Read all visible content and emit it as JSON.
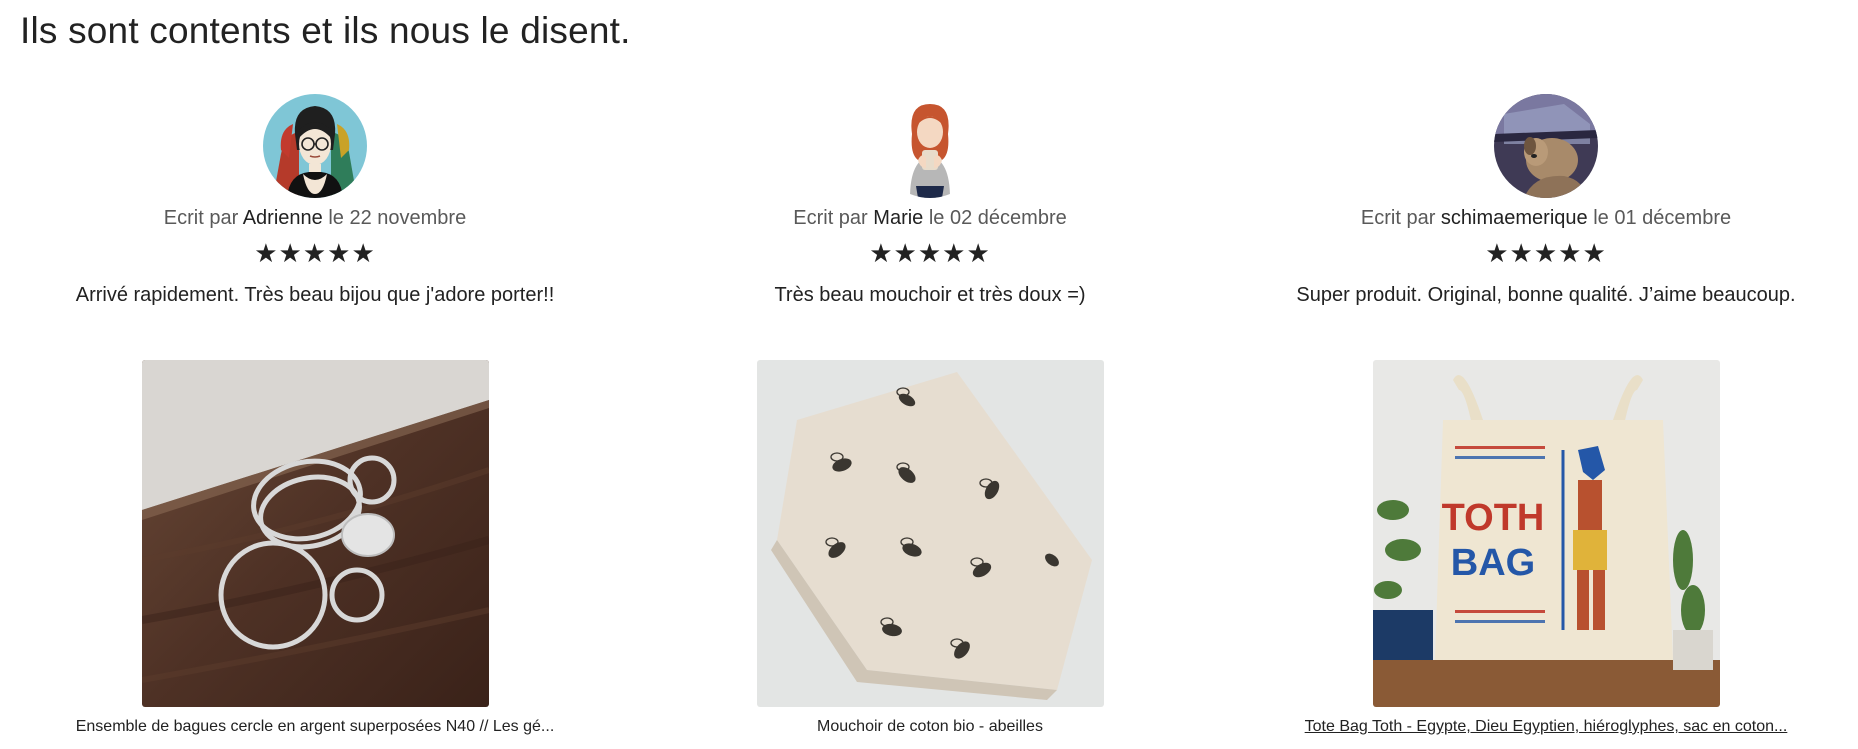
{
  "heading": "Ils sont contents et ils nous le disent.",
  "byline_prefix": "Ecrit par",
  "byline_date_prefix": "le",
  "rating_max": 5,
  "colors": {
    "text": "#222222",
    "muted": "#595959",
    "background": "#ffffff"
  },
  "reviews": [
    {
      "author": "Adrienne",
      "date": "22 novembre",
      "rating": 5,
      "text": "Arrivé rapidement. Très beau bijou que j'adore porter!!",
      "avatar_icon": "illustrated-woman-glasses-avatar",
      "product_title": "Ensemble de bagues cercle en argent superposées N40 // Les gé...",
      "product_image": "silver-circle-rings-photo",
      "product_link": false
    },
    {
      "author": "Marie",
      "date": "02 décembre",
      "rating": 5,
      "text": "Très beau mouchoir et très doux =)",
      "avatar_icon": "illustrated-redhead-woman-avatar",
      "product_title": "Mouchoir de coton bio - abeilles",
      "product_image": "bee-print-handkerchief-photo",
      "product_link": false
    },
    {
      "author": "schimaemerique",
      "date": "01 décembre",
      "rating": 5,
      "text": "Super produit. Original, bonne qualité. J’aime beaucoup.",
      "avatar_icon": "dog-in-car-avatar",
      "product_title": "Tote Bag Toth - Egypte, Dieu Egyptien, hiéroglyphes, sac en coton...",
      "product_image": "toth-tote-bag-photo",
      "product_link": true,
      "product_image_text": [
        "TOTH",
        "BAG"
      ]
    }
  ]
}
